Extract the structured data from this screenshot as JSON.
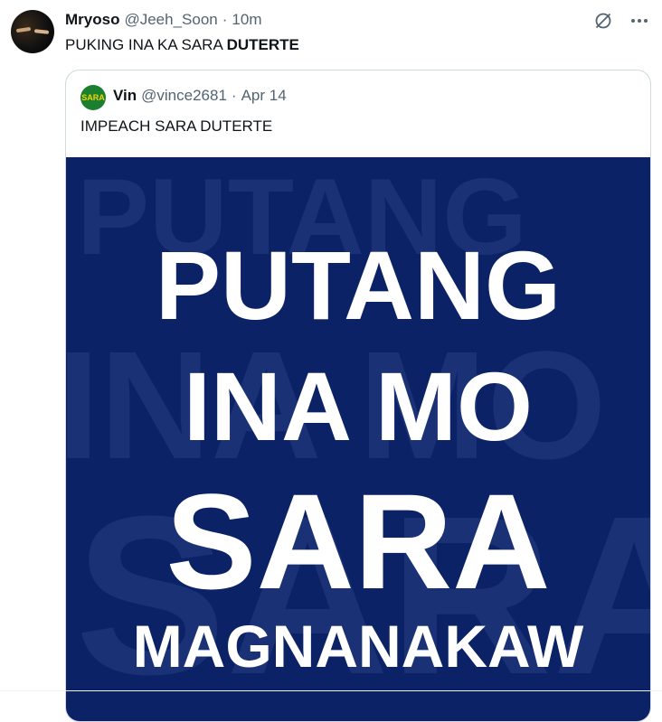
{
  "post": {
    "display_name": "Mryoso",
    "handle": "@Jeeh_Soon",
    "separator": "·",
    "time": "10m",
    "text_plain": "PUKING INA KA SARA ",
    "text_bold": "DUTERTE",
    "icons": {
      "grok": "grok-icon",
      "more": "more-icon"
    }
  },
  "quote": {
    "display_name": "Vin",
    "handle": "@vince2681",
    "separator": "·",
    "time": "Apr 14",
    "avatar_text": "SARA",
    "text": "IMPEACH SARA DUTERTE",
    "image": {
      "background_color": "#0b2266",
      "lines": [
        "PUTANG",
        "INA MO",
        "SARA",
        "MAGNANAKAW"
      ],
      "bg_lines": [
        "PUTANG",
        "INA MO",
        "SARA"
      ]
    }
  },
  "colors": {
    "text_primary": "#0f1419",
    "text_secondary": "#536471",
    "border": "#cfd9de",
    "image_bg": "#0b2266",
    "avatar_green": "#1a7f2e"
  }
}
